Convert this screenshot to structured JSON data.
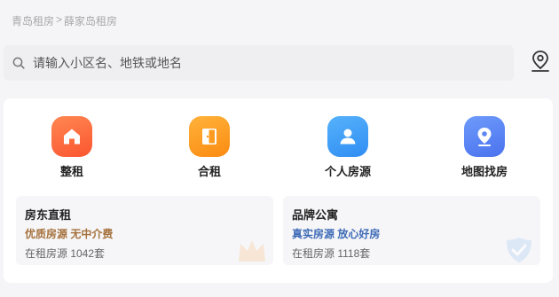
{
  "breadcrumb": {
    "city": "青岛租房",
    "separator": ">",
    "area": "薛家岛租房"
  },
  "search": {
    "placeholder": "请输入小区名、地铁或地名"
  },
  "categories": [
    {
      "label": "整租",
      "icon": "home-icon",
      "color": "#fd6a3c"
    },
    {
      "label": "合租",
      "icon": "door-icon",
      "color": "#fd9b1f"
    },
    {
      "label": "个人房源",
      "icon": "person-icon",
      "color": "#3d9cf7"
    },
    {
      "label": "地图找房",
      "icon": "map-pin-icon",
      "color": "#5c86f6"
    }
  ],
  "promos": [
    {
      "title": "房东直租",
      "slogan": "优质房源 无中介费",
      "slogan_color": "#a5713c",
      "count_text": "在租房源 1042套",
      "icon": "crown-icon"
    },
    {
      "title": "品牌公寓",
      "slogan": "真实房源 放心好房",
      "slogan_color": "#3e6bb6",
      "count_text": "在租房源 1118套",
      "icon": "shield-check-icon"
    }
  ]
}
